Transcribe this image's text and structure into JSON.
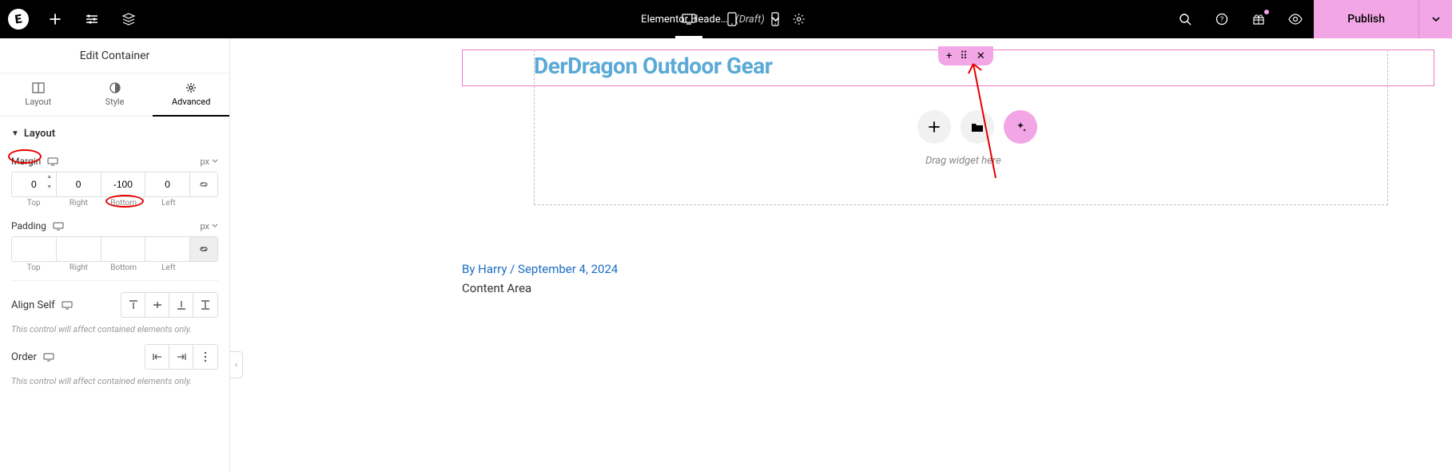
{
  "topbar": {
    "doc_title": "Elementor Heade…",
    "draft_label": "(Draft)",
    "publish_label": "Publish"
  },
  "sidebar": {
    "panel_title": "Edit Container",
    "tabs": {
      "layout": "Layout",
      "style": "Style",
      "advanced": "Advanced"
    },
    "section_layout": "Layout",
    "margin": {
      "label": "Margin",
      "unit": "px",
      "top": "0",
      "right": "0",
      "bottom": "-100",
      "left": "0",
      "top_lbl": "Top",
      "right_lbl": "Right",
      "bottom_lbl": "Bottom",
      "left_lbl": "Left"
    },
    "padding": {
      "label": "Padding",
      "unit": "px",
      "top": "",
      "right": "",
      "bottom": "",
      "left": "",
      "top_lbl": "Top",
      "right_lbl": "Right",
      "bottom_lbl": "Bottom",
      "left_lbl": "Left"
    },
    "align_self": {
      "label": "Align Self"
    },
    "order": {
      "label": "Order"
    },
    "note": "This control will affect contained elements only."
  },
  "canvas": {
    "site_title": "DerDragon Outdoor Gear",
    "drag_hint": "Drag widget here",
    "byline": "By Harry / September 4, 2024",
    "content": "Content Area"
  }
}
